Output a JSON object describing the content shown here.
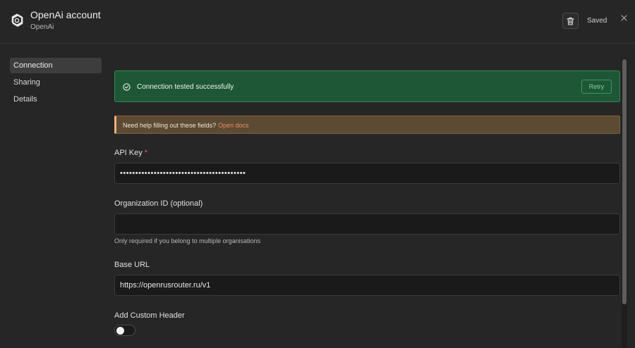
{
  "header": {
    "title": "OpenAi account",
    "subtitle": "OpenAi",
    "saved_label": "Saved"
  },
  "sidebar": {
    "items": [
      {
        "label": "Connection",
        "active": true
      },
      {
        "label": "Sharing",
        "active": false
      },
      {
        "label": "Details",
        "active": false
      }
    ]
  },
  "success_banner": {
    "text": "Connection tested successfully",
    "retry_label": "Retry"
  },
  "help_banner": {
    "text": "Need help filling out these fields?",
    "link": "Open docs"
  },
  "fields": {
    "api_key": {
      "label": "API Key",
      "required_mark": "*",
      "value": "•••••••••••••••••••••••••••••••••••••••••"
    },
    "organization_id": {
      "label": "Organization ID (optional)",
      "value": "",
      "hint": "Only required if you belong to multiple organisations"
    },
    "base_url": {
      "label": "Base URL",
      "value": "https://openrusrouter.ru/v1"
    },
    "custom_header": {
      "label": "Add Custom Header",
      "enabled": false
    }
  },
  "icons": {
    "app": "openai-logo-icon",
    "delete": "trash-icon",
    "close": "close-icon",
    "success": "check-circle-icon"
  },
  "colors": {
    "success_bg": "#1e5736",
    "success_border": "#2f8a52",
    "warning_bg": "#5c4a33",
    "warning_accent": "#e6b574",
    "link": "#f08a5d",
    "required": "#f05d5d"
  }
}
